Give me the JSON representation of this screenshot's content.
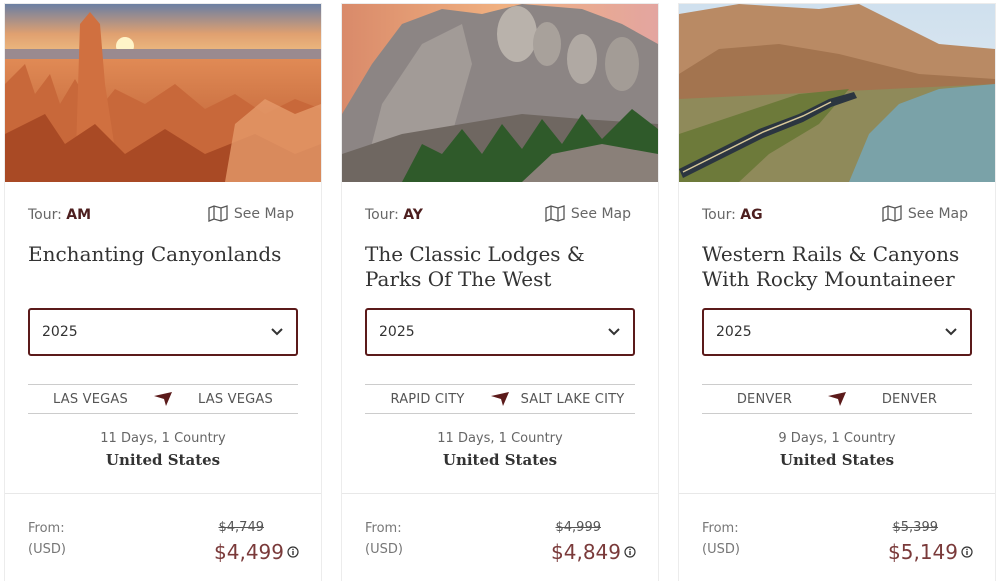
{
  "cards": [
    {
      "tour_prefix": "Tour: ",
      "tour_code": "AM",
      "see_map": "See Map",
      "title": "Enchanting Canyonlands",
      "year": "2025",
      "start_city": "LAS VEGAS",
      "end_city": "LAS VEGAS",
      "duration": "11 Days, 1 Country",
      "country": "United States",
      "from_label": "From:",
      "currency_label": "(USD)",
      "old_price": "$4,749",
      "price": "$4,499"
    },
    {
      "tour_prefix": "Tour: ",
      "tour_code": "AY",
      "see_map": "See Map",
      "title": "The Classic Lodges & Parks Of The West",
      "year": "2025",
      "start_city": "RAPID CITY",
      "end_city": "SALT LAKE CITY",
      "duration": "11 Days, 1 Country",
      "country": "United States",
      "from_label": "From:",
      "currency_label": "(USD)",
      "old_price": "$4,999",
      "price": "$4,849"
    },
    {
      "tour_prefix": "Tour: ",
      "tour_code": "AG",
      "see_map": "See Map",
      "title": "Western Rails & Canyons With Rocky Mountaineer",
      "year": "2025",
      "start_city": "DENVER",
      "end_city": "DENVER",
      "duration": "9 Days, 1 Country",
      "country": "United States",
      "from_label": "From:",
      "currency_label": "(USD)",
      "old_price": "$5,399",
      "price": "$5,149"
    }
  ],
  "colors": {
    "accent": "#5b1a1a",
    "price": "#7a3a3a",
    "tour_code": "#4d1f1f"
  },
  "icons": {
    "map": "map-icon",
    "dropdown": "chevron-down-icon",
    "route": "plane-arrow-icon",
    "info": "info-icon"
  }
}
